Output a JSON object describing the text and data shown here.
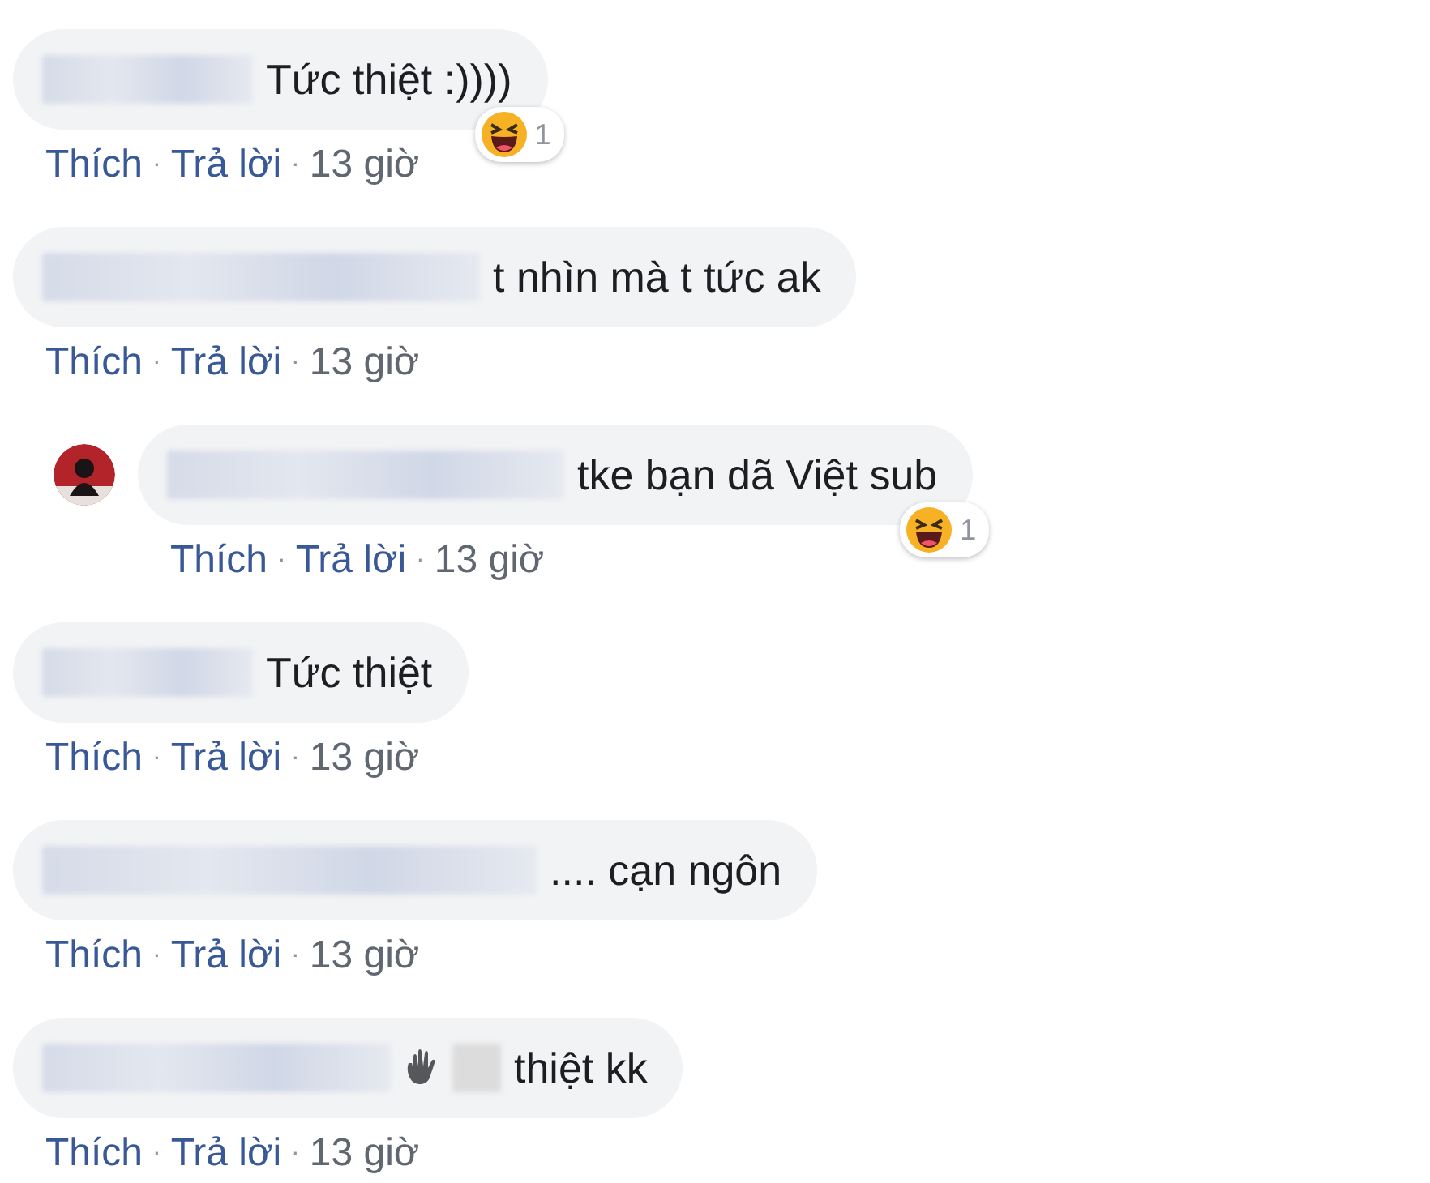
{
  "comments": [
    {
      "kind": "plain",
      "text": "Tức thiệt :))))",
      "reaction": {
        "count": "1"
      },
      "actions": [
        "Thích",
        "Trả lời"
      ],
      "separator": "·",
      "time": "13 giờ"
    },
    {
      "kind": "plain",
      "text": "t nhìn mà t tức ak",
      "actions": [
        "Thích",
        "Trả lời"
      ],
      "separator": "·",
      "time": "13 giờ"
    },
    {
      "kind": "reply",
      "text": "tke bạn dã Việt sub",
      "reaction": {
        "count": "1"
      },
      "actions": [
        "Thích",
        "Trả lời"
      ],
      "separator": "·",
      "time": "13 giờ"
    },
    {
      "kind": "plain",
      "text": "Tức thiệt",
      "actions": [
        "Thích",
        "Trả lời"
      ],
      "separator": "·",
      "time": "13 giờ"
    },
    {
      "kind": "plain",
      "text": ".... cạn ngôn",
      "actions": [
        "Thích",
        "Trả lời"
      ],
      "separator": "·",
      "time": "13 giờ"
    },
    {
      "kind": "wave",
      "text": "thiệt kk",
      "actions": [
        "Thích",
        "Trả lời"
      ],
      "separator": "·",
      "time": "13 giờ"
    }
  ]
}
